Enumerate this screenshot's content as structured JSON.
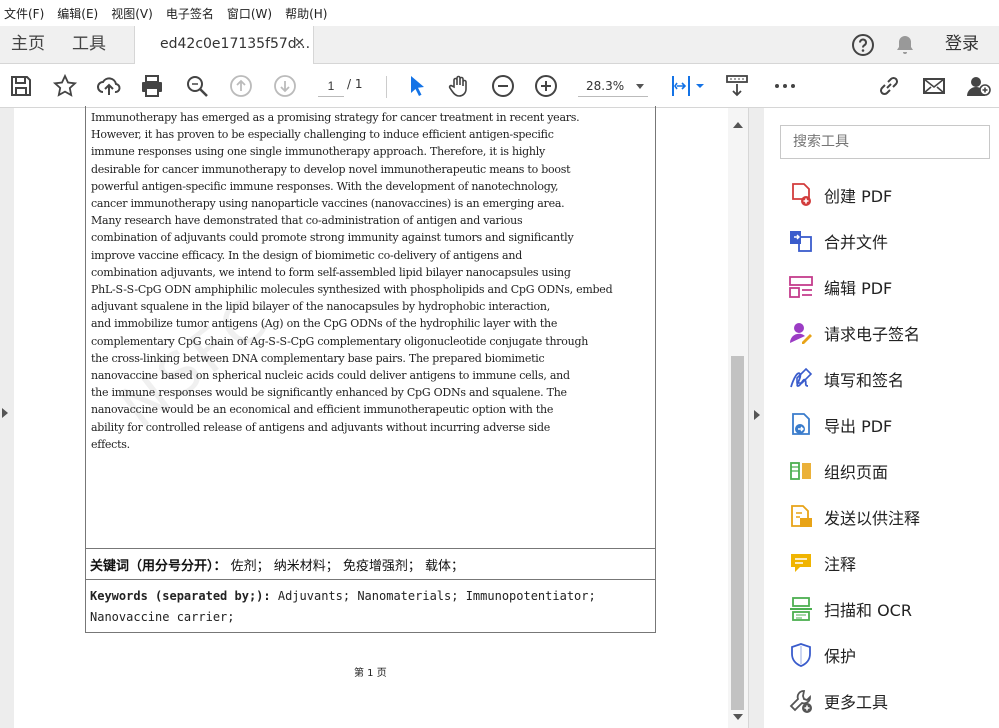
{
  "menu": [
    "文件(F)",
    "编辑(E)",
    "视图(V)",
    "电子签名",
    "窗口(W)",
    "帮助(H)"
  ],
  "tabs": {
    "home": "主页",
    "tools": "工具",
    "doc_title": "ed42c0e17135f57d...",
    "close": "✕"
  },
  "header": {
    "login": "登录"
  },
  "toolbar": {
    "page_current": "1",
    "page_total": "/ 1",
    "zoom": "28.3%"
  },
  "document": {
    "abstract": "Immunotherapy has emerged as a promising strategy for cancer treatment in recent years.\nHowever, it has proven to be especially challenging to induce efficient antigen-specific\nimmune responses using one single immunotherapy approach. Therefore, it is highly\ndesirable for cancer immunotherapy to develop novel immunotherapeutic means to boost\npowerful antigen-specific immune responses. With the development of nanotechnology,\ncancer immunotherapy using nanoparticle vaccines (nanovaccines) is an emerging area.\nMany research have demonstrated that co-administration of antigen and various\ncombination of adjuvants could promote strong immunity against tumors and significantly\nimprove vaccine efficacy. In the design of biomimetic co-delivery of antigens and\ncombination adjuvants, we intend to form self-assembled lipid bilayer nanocapsules using\nPhL-S-S-CpG ODN amphiphilic molecules synthesized with phospholipids and CpG ODNs, embed\nadjuvant squalene in the lipid bilayer of the nanocapsules by hydrophobic interaction,\nand immobilize tumor antigens (Ag) on the CpG ODNs of the hydrophilic layer with the\ncomplementary CpG chain of Ag-S-S-CpG complementary oligonucleotide conjugate through\nthe cross-linking between DNA complementary base pairs. The prepared biomimetic\nnanovaccine based on spherical nucleic acids could deliver antigens to immune cells, and\nthe immune responses would be significantly enhanced by CpG ODNs and squalene. The\nnanovaccine would be an economical and efficient immunotherapeutic option with the\nability for controlled release of antigens and adjuvants without incurring adverse side\neffects.",
    "keywords_cn_label": "关键词（用分号分开）：",
    "keywords_cn": "佐剂；  纳米材料；  免疫增强剂；  载体；",
    "keywords_en_label": "Keywords (separated by;):",
    "keywords_en": " Adjuvants;  Nanomaterials;  Immunopotentiator;\nNanovaccine carrier;",
    "page_label": "第 1 页",
    "watermark": "NSFC"
  },
  "panel": {
    "search_placeholder": "搜索工具",
    "tools": [
      {
        "label": "创建 PDF",
        "icon": "create-pdf-icon",
        "color": "#d23c3c"
      },
      {
        "label": "合并文件",
        "icon": "combine-files-icon",
        "color": "#3a5ccc"
      },
      {
        "label": "编辑 PDF",
        "icon": "edit-pdf-icon",
        "color": "#c43c8c"
      },
      {
        "label": "请求电子签名",
        "icon": "request-signature-icon",
        "color": "#9b3cc4"
      },
      {
        "label": "填写和签名",
        "icon": "fill-sign-icon",
        "color": "#3a5ccc"
      },
      {
        "label": "导出 PDF",
        "icon": "export-pdf-icon",
        "color": "#3a7ccc"
      },
      {
        "label": "组织页面",
        "icon": "organize-pages-icon",
        "color": "#4caf50"
      },
      {
        "label": "发送以供注释",
        "icon": "send-for-comments-icon",
        "color": "#e8a317"
      },
      {
        "label": "注释",
        "icon": "comment-icon",
        "color": "#f0b400"
      },
      {
        "label": "扫描和 OCR",
        "icon": "scan-ocr-icon",
        "color": "#4caf50"
      },
      {
        "label": "保护",
        "icon": "protect-icon",
        "color": "#3a5ccc"
      },
      {
        "label": "更多工具",
        "icon": "more-tools-icon",
        "color": "#555555"
      }
    ]
  }
}
